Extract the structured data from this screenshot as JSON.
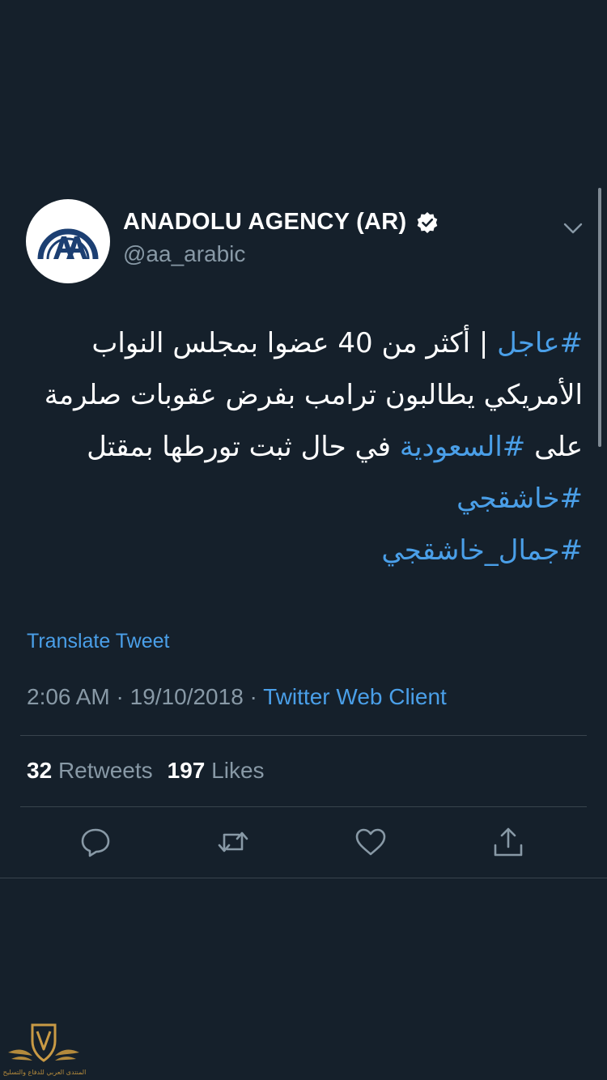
{
  "tweet": {
    "author": {
      "name": "ANADOLU AGENCY (AR)",
      "handle": "@aa_arabic",
      "avatar_text": "AA",
      "verified_icon": "verified-badge-icon"
    },
    "body": {
      "line1_hashtag": "#عاجل",
      "line1_text": " | أكثر من 40 عضوا بمجلس النواب",
      "line2_text": "الأمريكي يطالبون ترامب بفرض عقوبات صلرمة",
      "line3_pre": "على ",
      "line3_hashtag": "#السعودية",
      "line3_post": " في حال ثبت تورطها بمقتل",
      "line4_hashtag": "#خاشقجي",
      "line5_hashtag": "#جمال_خاشقجي"
    },
    "translate_label": "Translate Tweet",
    "time": "2:06 AM",
    "date": "19/10/2018",
    "separator": "·",
    "source": "Twitter Web Client",
    "stats": {
      "retweets_count": "32",
      "retweets_label": "Retweets",
      "likes_count": "197",
      "likes_label": "Likes"
    },
    "actions": [
      "reply-icon",
      "retweet-icon",
      "like-icon",
      "share-icon"
    ]
  },
  "watermark": {
    "text": "المنتدى العربي للدفاع والتسليح"
  },
  "colors": {
    "background": "#15202b",
    "link": "#4a9fe8",
    "secondary_text": "#8899a6",
    "divider": "#38444d"
  }
}
